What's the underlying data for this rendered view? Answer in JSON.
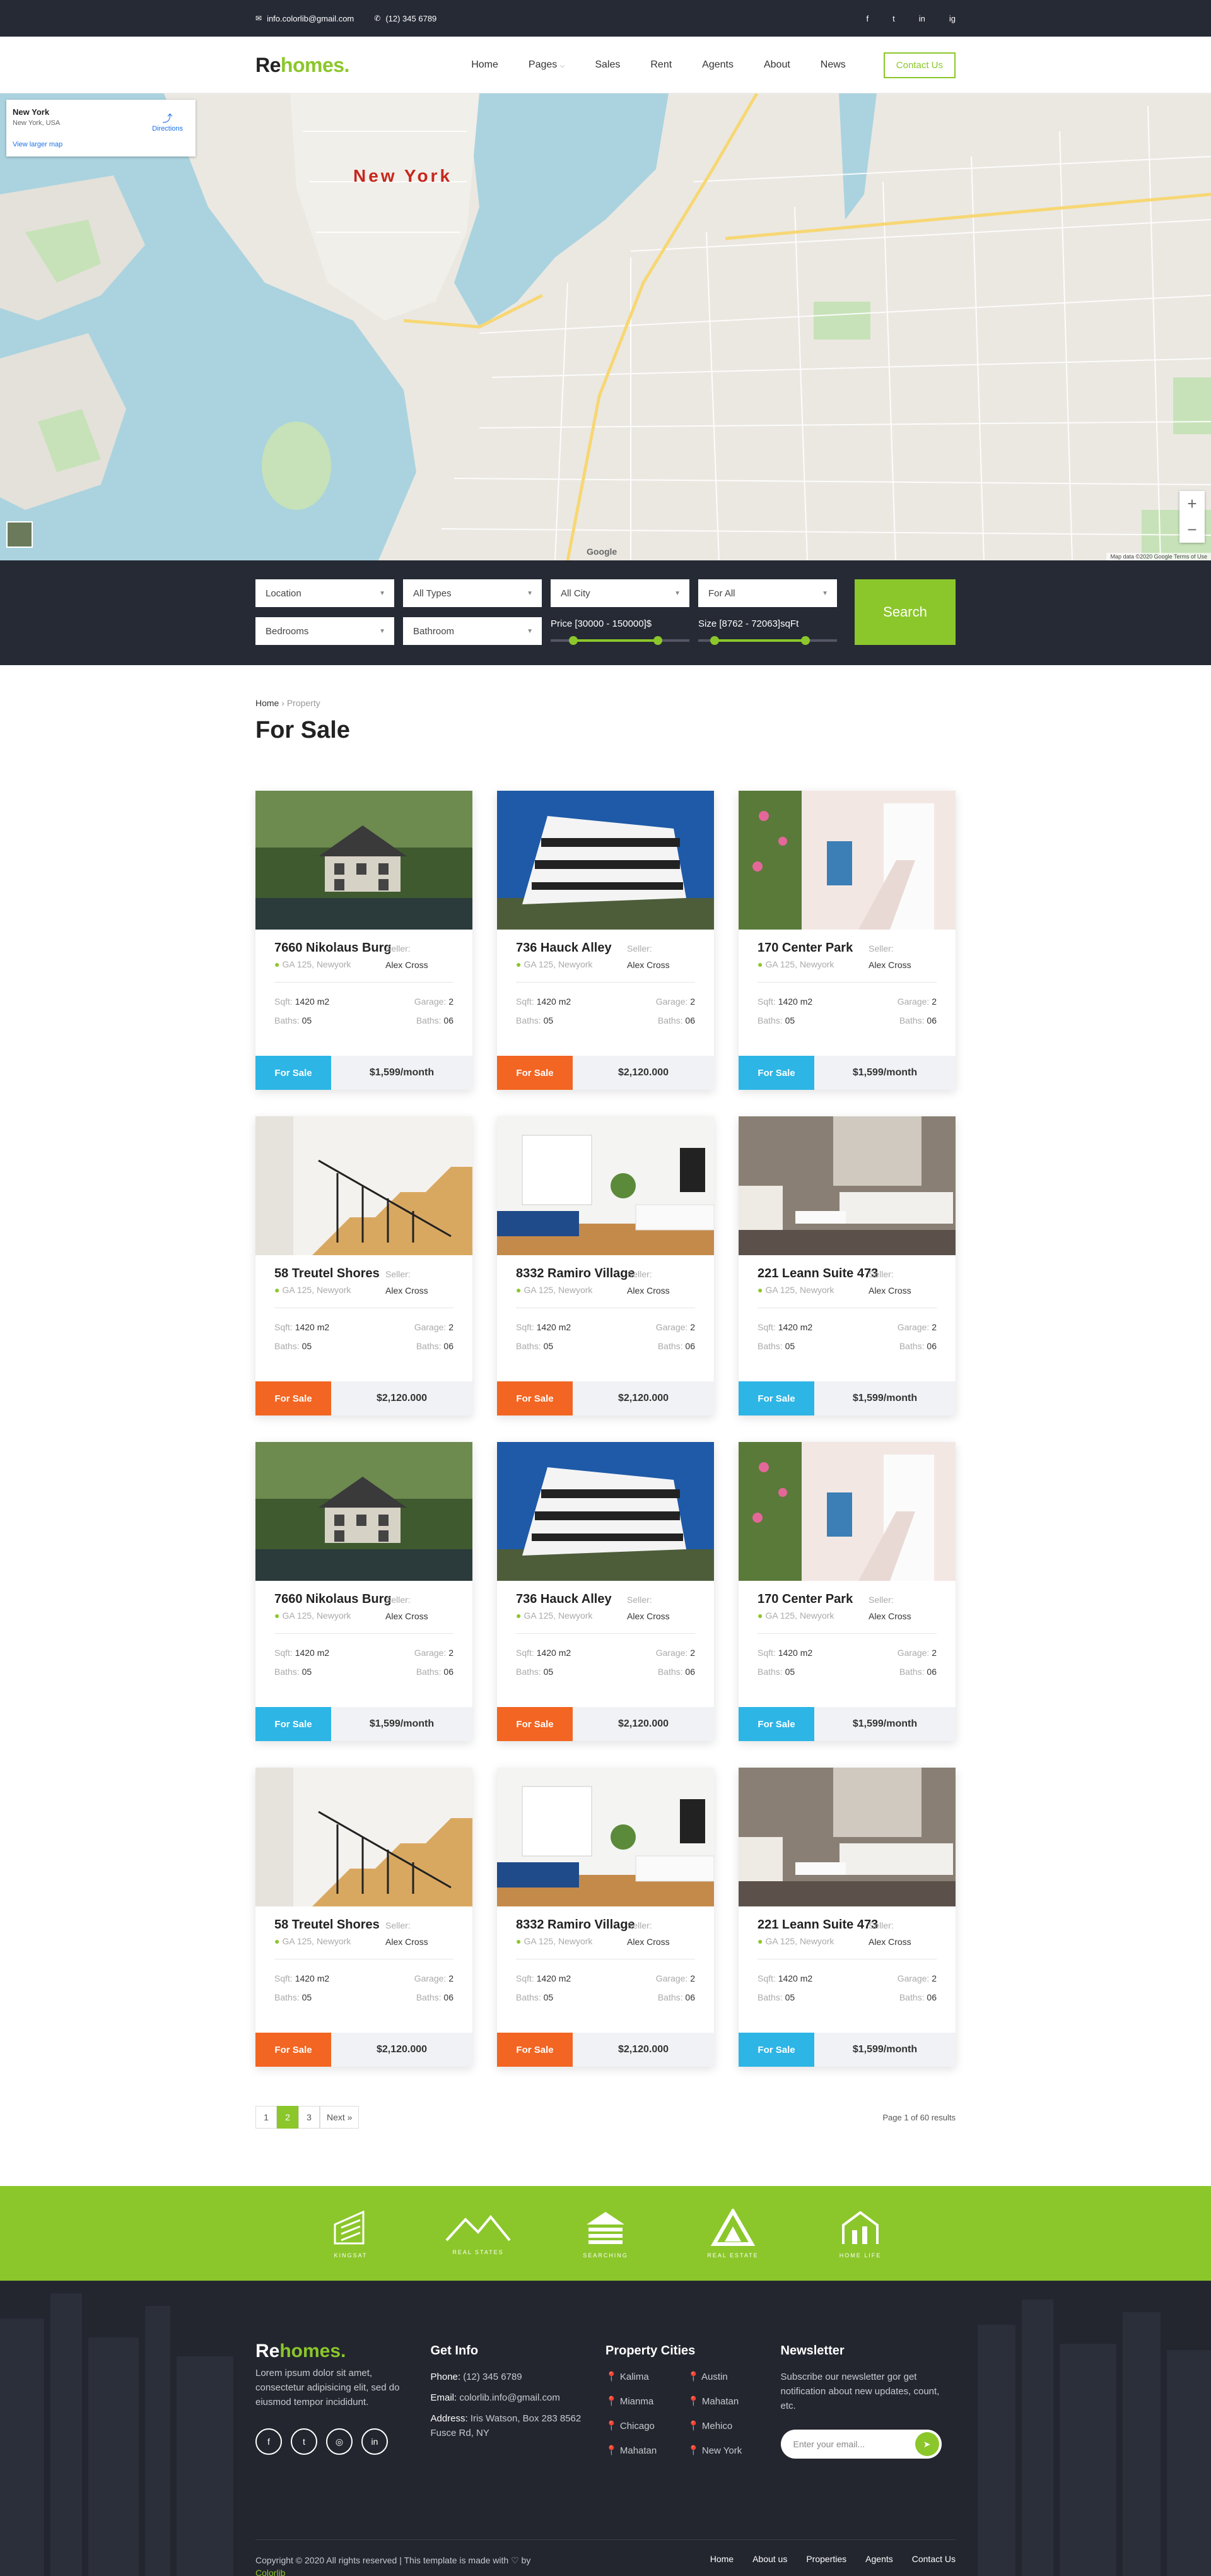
{
  "topbar": {
    "email": "info.colorlib@gmail.com",
    "phone": "(12) 345 6789",
    "social": [
      "f",
      "t",
      "in",
      "ig"
    ]
  },
  "header": {
    "logo_re": "Re",
    "logo_homes": "homes.",
    "nav": [
      "Home",
      "Pages",
      "Sales",
      "Rent",
      "Agents",
      "About",
      "News"
    ],
    "contact_label": "Contact Us"
  },
  "map": {
    "card_title": "New York",
    "card_sub": "New York, USA",
    "directions": "Directions",
    "larger_map": "View larger map",
    "city_label": "New York",
    "footer_text": "Map data ©2020 Google   Terms of Use",
    "google": "Google"
  },
  "search": {
    "location": "Location",
    "types": "All Types",
    "city": "All City",
    "for": "For All",
    "bedrooms": "Bedrooms",
    "bathroom": "Bathroom",
    "price_label": "Price [30000 - 150000]$",
    "size_label": "Size [8762 - 72063]sqFt",
    "button": "Search"
  },
  "page": {
    "breadcrumb_home": "Home",
    "breadcrumb_current": "Property",
    "title": "For Sale"
  },
  "spec_labels": {
    "sqft": "Sqft:",
    "baths": "Baths:",
    "garage": "Garage:",
    "seller": "Seller:",
    "loc": "GA 125, Newyork"
  },
  "listings": [
    {
      "title": "7660 Nikolaus Burg",
      "seller": "Alex Cross",
      "sqft": "1420 m2",
      "baths": "05",
      "garage": "2",
      "garage_baths": "06",
      "tag": "For Sale",
      "tag_color": "#2db5e5",
      "price": "$1,599/month",
      "img": "house"
    },
    {
      "title": "736 Hauck Alley",
      "seller": "Alex Cross",
      "sqft": "1420 m2",
      "baths": "05",
      "garage": "2",
      "garage_baths": "06",
      "tag": "For Sale",
      "tag_color": "#f26522",
      "price": "$2,120.000",
      "img": "modern"
    },
    {
      "title": "170 Center Park",
      "seller": "Alex Cross",
      "sqft": "1420 m2",
      "baths": "05",
      "garage": "2",
      "garage_baths": "06",
      "tag": "For Sale",
      "tag_color": "#2db5e5",
      "price": "$1,599/month",
      "img": "greek"
    },
    {
      "title": "58 Treutel Shores",
      "seller": "Alex Cross",
      "sqft": "1420 m2",
      "baths": "05",
      "garage": "2",
      "garage_baths": "06",
      "tag": "For Sale",
      "tag_color": "#f26522",
      "price": "$2,120.000",
      "img": "stairs"
    },
    {
      "title": "8332 Ramiro Village",
      "seller": "Alex Cross",
      "sqft": "1420 m2",
      "baths": "05",
      "garage": "2",
      "garage_baths": "06",
      "tag": "For Sale",
      "tag_color": "#f26522",
      "price": "$2,120.000",
      "img": "living"
    },
    {
      "title": "221 Leann Suite 473",
      "seller": "Alex Cross",
      "sqft": "1420 m2",
      "baths": "05",
      "garage": "2",
      "garage_baths": "06",
      "tag": "For Sale",
      "tag_color": "#2db5e5",
      "price": "$1,599/month",
      "img": "sofa"
    },
    {
      "title": "7660 Nikolaus Burg",
      "seller": "Alex Cross",
      "sqft": "1420 m2",
      "baths": "05",
      "garage": "2",
      "garage_baths": "06",
      "tag": "For Sale",
      "tag_color": "#2db5e5",
      "price": "$1,599/month",
      "img": "house"
    },
    {
      "title": "736 Hauck Alley",
      "seller": "Alex Cross",
      "sqft": "1420 m2",
      "baths": "05",
      "garage": "2",
      "garage_baths": "06",
      "tag": "For Sale",
      "tag_color": "#f26522",
      "price": "$2,120.000",
      "img": "modern"
    },
    {
      "title": "170 Center Park",
      "seller": "Alex Cross",
      "sqft": "1420 m2",
      "baths": "05",
      "garage": "2",
      "garage_baths": "06",
      "tag": "For Sale",
      "tag_color": "#2db5e5",
      "price": "$1,599/month",
      "img": "greek"
    },
    {
      "title": "58 Treutel Shores",
      "seller": "Alex Cross",
      "sqft": "1420 m2",
      "baths": "05",
      "garage": "2",
      "garage_baths": "06",
      "tag": "For Sale",
      "tag_color": "#f26522",
      "price": "$2,120.000",
      "img": "stairs"
    },
    {
      "title": "8332 Ramiro Village",
      "seller": "Alex Cross",
      "sqft": "1420 m2",
      "baths": "05",
      "garage": "2",
      "garage_baths": "06",
      "tag": "For Sale",
      "tag_color": "#f26522",
      "price": "$2,120.000",
      "img": "living"
    },
    {
      "title": "221 Leann Suite 473",
      "seller": "Alex Cross",
      "sqft": "1420 m2",
      "baths": "05",
      "garage": "2",
      "garage_baths": "06",
      "tag": "For Sale",
      "tag_color": "#2db5e5",
      "price": "$1,599/month",
      "img": "sofa"
    }
  ],
  "pagination": {
    "pages": [
      "1",
      "2",
      "3"
    ],
    "active": "2",
    "next": "Next »",
    "info": "Page 1 of 60 results"
  },
  "partners": [
    "KINGSAT",
    "REAL STATES",
    "SEARCHING",
    "REAL ESTATE",
    "HOME LIFE"
  ],
  "footer": {
    "logo_re": "Re",
    "logo_homes": "homes.",
    "about": "Lorem ipsum dolor sit amet, consectetur adipisicing elit, sed do eiusmod tempor incididunt.",
    "get_info_title": "Get Info",
    "phone_label": "Phone:",
    "phone": "(12) 345 6789",
    "email_label": "Email:",
    "email": "colorlib.info@gmail.com",
    "address_label": "Address:",
    "address": "Iris Watson, Box 283 8562 Fusce Rd, NY",
    "cities_title": "Property Cities",
    "cities": [
      "Kalima",
      "Austin",
      "Mianma",
      "Mahatan",
      "Chicago",
      "Mehico",
      "Mahatan",
      "New York"
    ],
    "newsletter_title": "Newsletter",
    "newsletter_text": "Subscribe our newsletter gor get notification about new updates, count, etc.",
    "email_placeholder": "Enter your email...",
    "copyright": "Copyright © 2020 All rights reserved | This template is made with ♡ by",
    "copyright_link": "Colorlib",
    "links": [
      "Home",
      "About us",
      "Properties",
      "Agents",
      "Contact Us"
    ]
  }
}
